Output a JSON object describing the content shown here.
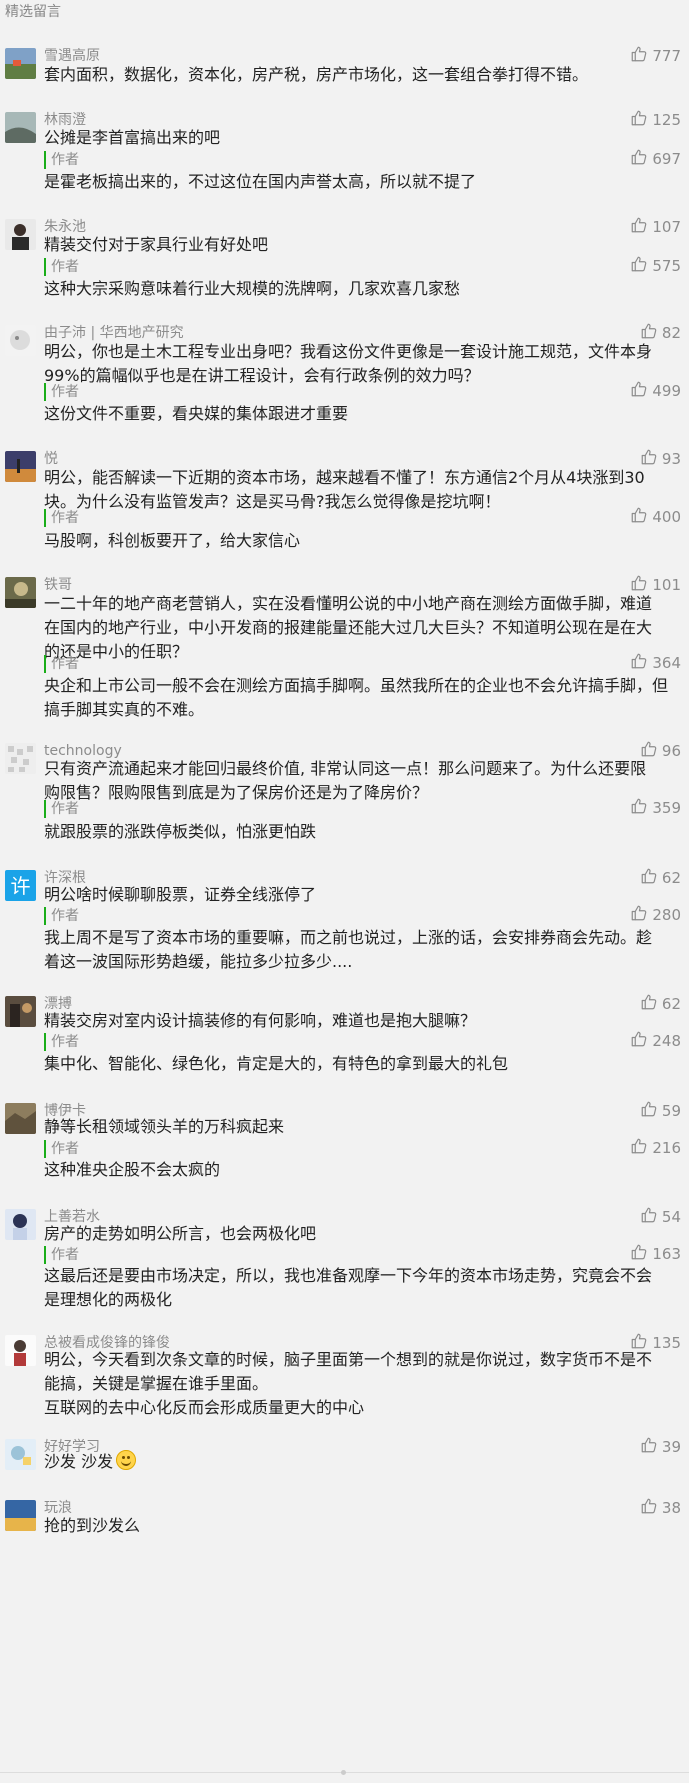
{
  "section_title": "精选留言",
  "author_label": "作者",
  "colors": {
    "accent": "#1aad19",
    "meta": "#8c8c8c",
    "text": "#222222",
    "background": "#f2f2f2"
  },
  "icons": {
    "like": "thumbs-up-icon"
  },
  "comments": [
    {
      "nickname": "雪遇高原",
      "likes": "777",
      "text": [
        "套内面积，数据化，资本化，房产税，房产市场化，这一套组合拳打得不错。"
      ],
      "reply": null
    },
    {
      "nickname": "林雨澄",
      "likes": "125",
      "text": [
        "公摊是李首富搞出来的吧"
      ],
      "reply": {
        "likes": "697",
        "text": [
          "是霍老板搞出来的，不过这位在国内声誉太高，所以就不提了"
        ]
      }
    },
    {
      "nickname": "朱永池",
      "likes": "107",
      "text": [
        "精装交付对于家具行业有好处吧"
      ],
      "reply": {
        "likes": "575",
        "text": [
          "这种大宗采购意味着行业大规模的洗牌啊，几家欢喜几家愁"
        ]
      }
    },
    {
      "nickname": "由子沛 | 华西地产研究",
      "likes": "82",
      "text": [
        "明公，你也是土木工程专业出身吧？我看这份文件更像是一套设计施工规范，文件本身",
        "99%的篇幅似乎也是在讲工程设计，会有行政条例的效力吗？"
      ],
      "reply": {
        "likes": "499",
        "text": [
          "这份文件不重要，看央媒的集体跟进才重要"
        ]
      }
    },
    {
      "nickname": "悦",
      "likes": "93",
      "text": [
        "明公，能否解读一下近期的资本市场，越来越看不懂了！东方通信2个月从4块涨到30",
        "块。为什么没有监管发声？这是买马骨?我怎么觉得像是挖坑啊！"
      ],
      "reply": {
        "likes": "400",
        "text": [
          "马股啊，科创板要开了，给大家信心"
        ]
      }
    },
    {
      "nickname": "铁哥",
      "likes": "101",
      "text": [
        "一二十年的地产商老营销人，实在没看懂明公说的中小地产商在测绘方面做手脚，难道",
        "在国内的地产行业，中小开发商的报建能量还能大过几大巨头？不知道明公现在是在大",
        "的还是中小的任职？"
      ],
      "reply": {
        "likes": "364",
        "text": [
          "央企和上市公司一般不会在测绘方面搞手脚啊。虽然我所在的企业也不会允许搞手脚，但",
          "搞手脚其实真的不难。"
        ]
      }
    },
    {
      "nickname": "technology",
      "likes": "96",
      "text": [
        "只有资产流通起来才能回归最终价值, 非常认同这一点！那么问题来了。为什么还要限",
        "购限售？限购限售到底是为了保房价还是为了降房价？"
      ],
      "reply": {
        "likes": "359",
        "text": [
          "就跟股票的涨跌停板类似，怕涨更怕跌"
        ]
      }
    },
    {
      "nickname": "许深根",
      "likes": "62",
      "text": [
        "明公啥时候聊聊股票，证券全线涨停了"
      ],
      "reply": {
        "likes": "280",
        "text": [
          "我上周不是写了资本市场的重要嘛，而之前也说过，上涨的话，会安排券商会先动。趁",
          "着这一波国际形势趋缓，能拉多少拉多少...."
        ]
      }
    },
    {
      "nickname": "漂搏",
      "likes": "62",
      "text": [
        "精装交房对室内设计搞装修的有何影响，难道也是抱大腿嘛？"
      ],
      "reply": {
        "likes": "248",
        "text": [
          "集中化、智能化、绿色化，肯定是大的，有特色的拿到最大的礼包"
        ]
      }
    },
    {
      "nickname": "博伊卡",
      "likes": "59",
      "text": [
        "静等长租领域领头羊的万科疯起来"
      ],
      "reply": {
        "likes": "216",
        "text": [
          "这种准央企股不会太疯的"
        ]
      }
    },
    {
      "nickname": "上善若水",
      "likes": "54",
      "text": [
        "房产的走势如明公所言，也会两极化吧"
      ],
      "reply": {
        "likes": "163",
        "text": [
          "这最后还是要由市场决定，所以，我也准备观摩一下今年的资本市场走势，究竟会不会",
          "是理想化的两极化"
        ]
      }
    },
    {
      "nickname": "总被看成俊锋的锋俊",
      "likes": "135",
      "text": [
        "明公，今天看到次条文章的时候，脑子里面第一个想到的就是你说过，数字货币不是不",
        "能搞，关键是掌握在谁手里面。",
        "互联网的去中心化反而会形成质量更大的中心"
      ],
      "reply": null
    },
    {
      "nickname": "好好学习",
      "likes": "39",
      "text": [
        "沙发 沙发"
      ],
      "reply": null
    },
    {
      "nickname": "玩浪",
      "likes": "38",
      "text": [
        "抢的到沙发么"
      ],
      "reply": null
    }
  ]
}
